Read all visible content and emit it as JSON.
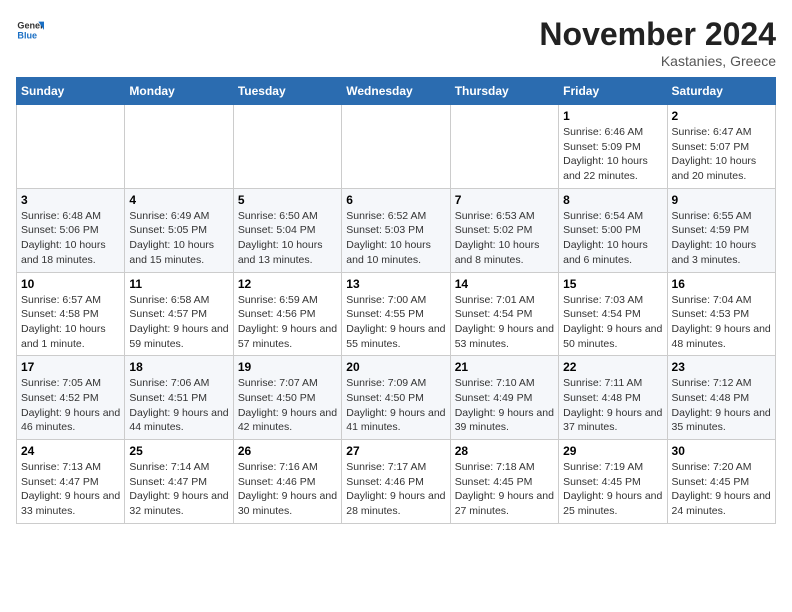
{
  "header": {
    "logo_general": "General",
    "logo_blue": "Blue",
    "month_title": "November 2024",
    "location": "Kastanies, Greece"
  },
  "weekdays": [
    "Sunday",
    "Monday",
    "Tuesday",
    "Wednesday",
    "Thursday",
    "Friday",
    "Saturday"
  ],
  "weeks": [
    [
      {
        "day": "",
        "info": ""
      },
      {
        "day": "",
        "info": ""
      },
      {
        "day": "",
        "info": ""
      },
      {
        "day": "",
        "info": ""
      },
      {
        "day": "",
        "info": ""
      },
      {
        "day": "1",
        "info": "Sunrise: 6:46 AM\nSunset: 5:09 PM\nDaylight: 10 hours and 22 minutes."
      },
      {
        "day": "2",
        "info": "Sunrise: 6:47 AM\nSunset: 5:07 PM\nDaylight: 10 hours and 20 minutes."
      }
    ],
    [
      {
        "day": "3",
        "info": "Sunrise: 6:48 AM\nSunset: 5:06 PM\nDaylight: 10 hours and 18 minutes."
      },
      {
        "day": "4",
        "info": "Sunrise: 6:49 AM\nSunset: 5:05 PM\nDaylight: 10 hours and 15 minutes."
      },
      {
        "day": "5",
        "info": "Sunrise: 6:50 AM\nSunset: 5:04 PM\nDaylight: 10 hours and 13 minutes."
      },
      {
        "day": "6",
        "info": "Sunrise: 6:52 AM\nSunset: 5:03 PM\nDaylight: 10 hours and 10 minutes."
      },
      {
        "day": "7",
        "info": "Sunrise: 6:53 AM\nSunset: 5:02 PM\nDaylight: 10 hours and 8 minutes."
      },
      {
        "day": "8",
        "info": "Sunrise: 6:54 AM\nSunset: 5:00 PM\nDaylight: 10 hours and 6 minutes."
      },
      {
        "day": "9",
        "info": "Sunrise: 6:55 AM\nSunset: 4:59 PM\nDaylight: 10 hours and 3 minutes."
      }
    ],
    [
      {
        "day": "10",
        "info": "Sunrise: 6:57 AM\nSunset: 4:58 PM\nDaylight: 10 hours and 1 minute."
      },
      {
        "day": "11",
        "info": "Sunrise: 6:58 AM\nSunset: 4:57 PM\nDaylight: 9 hours and 59 minutes."
      },
      {
        "day": "12",
        "info": "Sunrise: 6:59 AM\nSunset: 4:56 PM\nDaylight: 9 hours and 57 minutes."
      },
      {
        "day": "13",
        "info": "Sunrise: 7:00 AM\nSunset: 4:55 PM\nDaylight: 9 hours and 55 minutes."
      },
      {
        "day": "14",
        "info": "Sunrise: 7:01 AM\nSunset: 4:54 PM\nDaylight: 9 hours and 53 minutes."
      },
      {
        "day": "15",
        "info": "Sunrise: 7:03 AM\nSunset: 4:54 PM\nDaylight: 9 hours and 50 minutes."
      },
      {
        "day": "16",
        "info": "Sunrise: 7:04 AM\nSunset: 4:53 PM\nDaylight: 9 hours and 48 minutes."
      }
    ],
    [
      {
        "day": "17",
        "info": "Sunrise: 7:05 AM\nSunset: 4:52 PM\nDaylight: 9 hours and 46 minutes."
      },
      {
        "day": "18",
        "info": "Sunrise: 7:06 AM\nSunset: 4:51 PM\nDaylight: 9 hours and 44 minutes."
      },
      {
        "day": "19",
        "info": "Sunrise: 7:07 AM\nSunset: 4:50 PM\nDaylight: 9 hours and 42 minutes."
      },
      {
        "day": "20",
        "info": "Sunrise: 7:09 AM\nSunset: 4:50 PM\nDaylight: 9 hours and 41 minutes."
      },
      {
        "day": "21",
        "info": "Sunrise: 7:10 AM\nSunset: 4:49 PM\nDaylight: 9 hours and 39 minutes."
      },
      {
        "day": "22",
        "info": "Sunrise: 7:11 AM\nSunset: 4:48 PM\nDaylight: 9 hours and 37 minutes."
      },
      {
        "day": "23",
        "info": "Sunrise: 7:12 AM\nSunset: 4:48 PM\nDaylight: 9 hours and 35 minutes."
      }
    ],
    [
      {
        "day": "24",
        "info": "Sunrise: 7:13 AM\nSunset: 4:47 PM\nDaylight: 9 hours and 33 minutes."
      },
      {
        "day": "25",
        "info": "Sunrise: 7:14 AM\nSunset: 4:47 PM\nDaylight: 9 hours and 32 minutes."
      },
      {
        "day": "26",
        "info": "Sunrise: 7:16 AM\nSunset: 4:46 PM\nDaylight: 9 hours and 30 minutes."
      },
      {
        "day": "27",
        "info": "Sunrise: 7:17 AM\nSunset: 4:46 PM\nDaylight: 9 hours and 28 minutes."
      },
      {
        "day": "28",
        "info": "Sunrise: 7:18 AM\nSunset: 4:45 PM\nDaylight: 9 hours and 27 minutes."
      },
      {
        "day": "29",
        "info": "Sunrise: 7:19 AM\nSunset: 4:45 PM\nDaylight: 9 hours and 25 minutes."
      },
      {
        "day": "30",
        "info": "Sunrise: 7:20 AM\nSunset: 4:45 PM\nDaylight: 9 hours and 24 minutes."
      }
    ]
  ]
}
